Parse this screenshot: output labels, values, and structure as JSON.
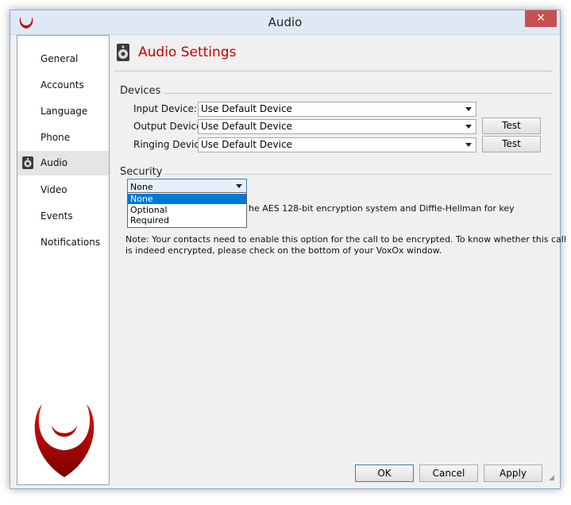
{
  "window": {
    "title": "Audio",
    "close_label": "✕"
  },
  "sidebar": {
    "items": [
      {
        "label": "General"
      },
      {
        "label": "Accounts"
      },
      {
        "label": "Language"
      },
      {
        "label": "Phone"
      },
      {
        "label": "Audio",
        "selected": true
      },
      {
        "label": "Video"
      },
      {
        "label": "Events"
      },
      {
        "label": "Notifications"
      }
    ]
  },
  "main": {
    "title": "Audio Settings",
    "devices": {
      "group_label": "Devices",
      "input_label": "Input Device:",
      "input_value": "Use Default Device",
      "output_label": "Output Device:",
      "output_value": "Use Default Device",
      "ringing_label": "Ringing Device:",
      "ringing_value": "Use Default Device",
      "test_label": "Test"
    },
    "security": {
      "group_label": "Security",
      "selected": "None",
      "options": [
        "None",
        "Optional",
        "Required"
      ],
      "description_partial": "he AES 128-bit encryption system and Diffie-Hellman for key",
      "note_line1": "Note: Your contacts need to enable this option for the call to be encrypted. To know whether this call",
      "note_line2": "is indeed encrypted, please check on the bottom of your VoxOx window."
    }
  },
  "footer": {
    "ok_label": "OK",
    "cancel_label": "Cancel",
    "apply_label": "Apply"
  },
  "colors": {
    "accent_red": "#c80000",
    "highlight": "#0078d7",
    "close_red": "#c75050"
  }
}
